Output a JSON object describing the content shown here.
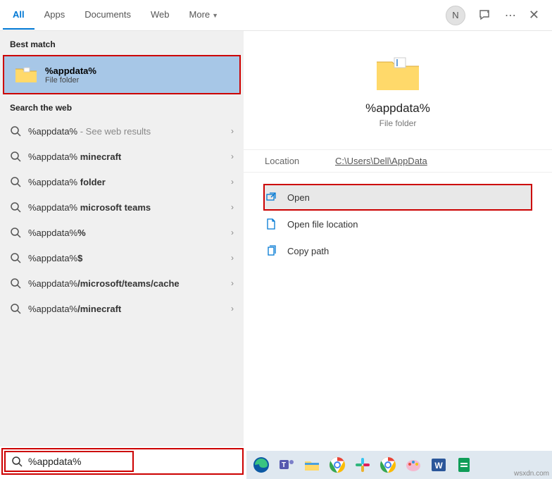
{
  "tabs": {
    "all": "All",
    "apps": "Apps",
    "documents": "Documents",
    "web": "Web",
    "more": "More"
  },
  "avatar_initial": "N",
  "left": {
    "best_match_h": "Best match",
    "best": {
      "title": "%appdata%",
      "sub": "File folder"
    },
    "search_web_h": "Search the web",
    "rows": [
      {
        "prefix": "%appdata%",
        "suffix": " - See web results",
        "bold": ""
      },
      {
        "prefix": "%appdata% ",
        "bold": "minecraft",
        "suffix": ""
      },
      {
        "prefix": "%appdata% ",
        "bold": "folder",
        "suffix": ""
      },
      {
        "prefix": "%appdata% ",
        "bold": "microsoft teams",
        "suffix": ""
      },
      {
        "prefix": "%appdata%",
        "bold": "%",
        "suffix": ""
      },
      {
        "prefix": "%appdata%",
        "bold": "$",
        "suffix": ""
      },
      {
        "prefix": "%appdata%",
        "bold": "/microsoft/teams/cache",
        "suffix": ""
      },
      {
        "prefix": "%appdata%",
        "bold": "/minecraft",
        "suffix": ""
      }
    ]
  },
  "right": {
    "title": "%appdata%",
    "sub": "File folder",
    "loc_label": "Location",
    "loc_val": "C:\\Users\\Dell\\AppData",
    "actions": {
      "open": "Open",
      "openloc": "Open file location",
      "copy": "Copy path"
    }
  },
  "search_query": "%appdata%",
  "watermark": "wsxdn.com"
}
